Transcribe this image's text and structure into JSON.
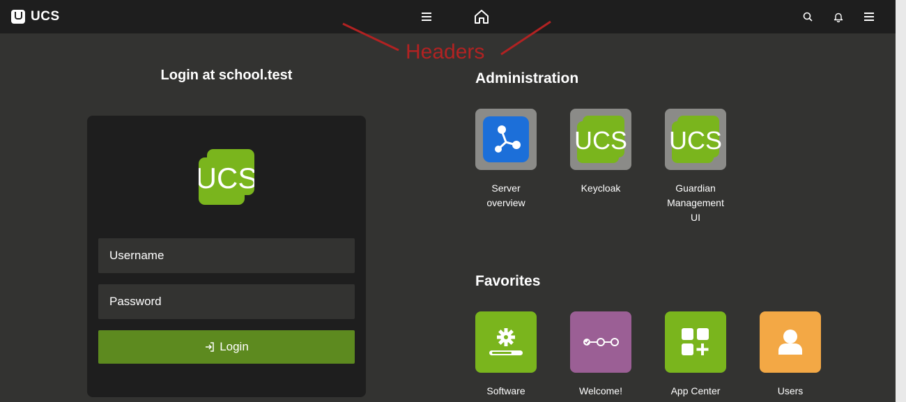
{
  "topbar": {
    "brand": "UCS",
    "icons": [
      "menu-icon",
      "home-icon",
      "search-icon",
      "bell-icon",
      "menu-icon"
    ]
  },
  "annotation": {
    "label": "Headers",
    "color": "#b22222"
  },
  "login": {
    "title": "Login at school.test",
    "logo_text": "UCS",
    "username_placeholder": "Username",
    "password_placeholder": "Password",
    "button_label": "Login"
  },
  "administration": {
    "title": "Administration",
    "tiles": [
      {
        "label_line1": "Server",
        "label_line2": "overview",
        "label_line3": ""
      },
      {
        "label_line1": "Keycloak",
        "label_line2": "",
        "label_line3": ""
      },
      {
        "label_line1": "Guardian",
        "label_line2": "Management",
        "label_line3": "UI"
      }
    ],
    "tile_logo_text": "UCS"
  },
  "favorites": {
    "title": "Favorites",
    "tiles": [
      {
        "label": "Software",
        "color": "#7ab51d"
      },
      {
        "label": "Welcome!",
        "color": "#9b5f95"
      },
      {
        "label": "App Center",
        "color": "#7ab51d"
      },
      {
        "label": "Users",
        "color": "#f3a845"
      }
    ]
  },
  "colors": {
    "topbar": "#1e1e1e",
    "background": "#333331",
    "brand_green": "#7ab51d",
    "login_button": "#5d8a1f",
    "tile_gray": "#8b8b88",
    "server_blue": "#1c6fd9"
  }
}
